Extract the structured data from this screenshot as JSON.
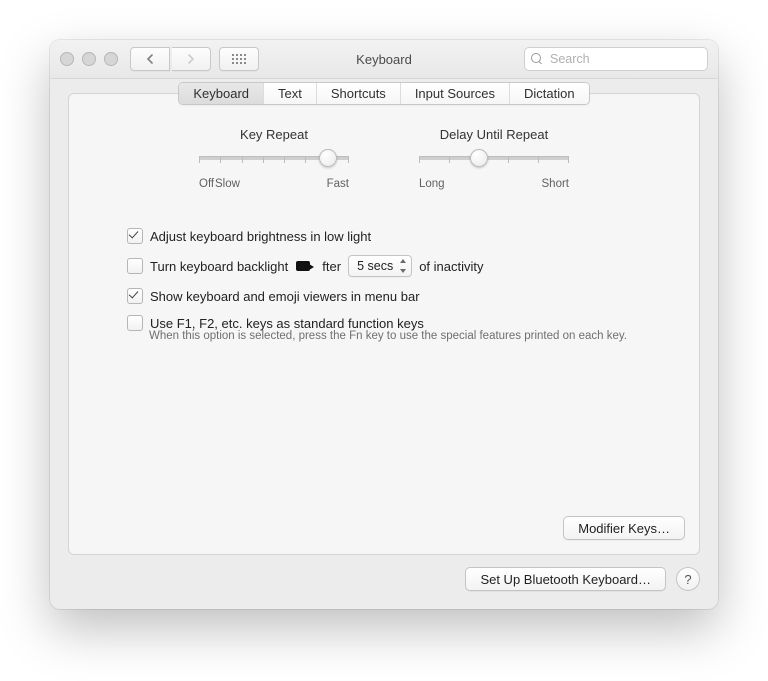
{
  "window": {
    "title": "Keyboard",
    "search_placeholder": "Search"
  },
  "tabs": {
    "items": [
      "Keyboard",
      "Text",
      "Shortcuts",
      "Input Sources",
      "Dictation"
    ],
    "active_index": 0
  },
  "sliders": {
    "key_repeat": {
      "label": "Key Repeat",
      "left": "Off",
      "left2": "Slow",
      "right": "Fast",
      "ticks": 8,
      "value_index": 6
    },
    "delay": {
      "label": "Delay Until Repeat",
      "left": "Long",
      "right": "Short",
      "ticks": 6,
      "value_index": 2
    }
  },
  "options": {
    "brightness": {
      "checked": true,
      "label": "Adjust keyboard brightness in low light"
    },
    "backlight_off": {
      "checked": false,
      "label_pre": "Turn off keyboard backlight after",
      "select_value": "5 secs",
      "label_post": "of inactivity"
    },
    "emoji_viewer": {
      "checked": true,
      "label": "Show keyboard and emoji viewers in menu bar"
    },
    "fn_keys": {
      "checked": false,
      "label": "Use F1, F2, etc. keys as standard function keys",
      "hint": "When this option is selected, press the Fn key to use the special features printed on each key."
    }
  },
  "buttons": {
    "modifier": "Modifier Keys…",
    "bluetooth": "Set Up Bluetooth Keyboard…",
    "help": "?"
  }
}
